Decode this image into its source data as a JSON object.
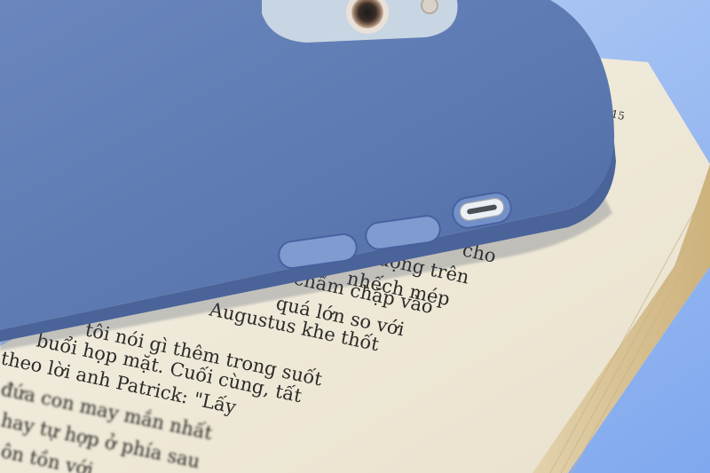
{
  "photo": {
    "background_color": "#9fc0f2",
    "case_color": "#5b78b0",
    "page_color": "#f3eedf",
    "page_number": "15",
    "book_lines": [
      "cho",
      "động trên",
      "nhếch mép",
      "chầm chặp vào",
      "quá lớn so với",
      "Augustus khe thốt",
      "tôi nói gì thêm trong suốt",
      "buổi họp mặt. Cuối cùng, tất",
      "theo lời anh Patrick: \"Lấy",
      "đứa con may mắn nhất",
      "hay tự hợp ở phía sau",
      "ôn tồn với"
    ]
  }
}
